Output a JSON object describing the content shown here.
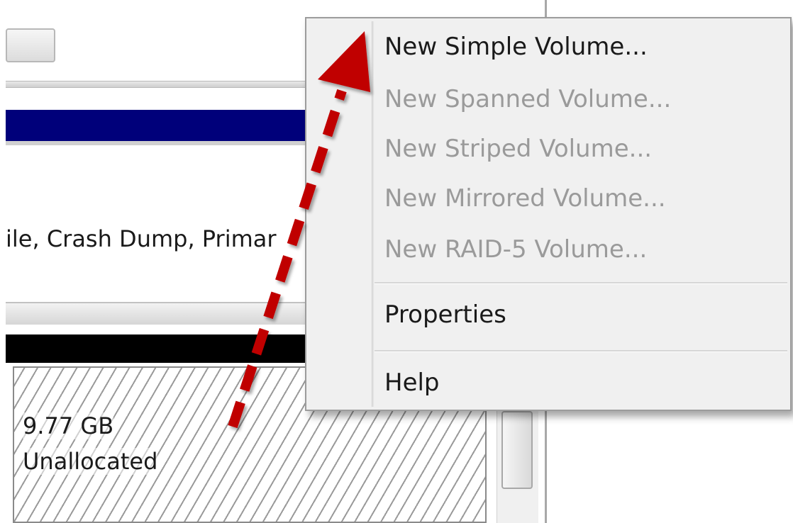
{
  "background": {
    "partition_status": "ile, Crash Dump, Primar",
    "unallocated": {
      "size": "9.77 GB",
      "label": "Unallocated"
    }
  },
  "context_menu": {
    "items": [
      {
        "label": "New Simple Volume...",
        "enabled": true
      },
      {
        "label": "New Spanned Volume...",
        "enabled": false
      },
      {
        "label": "New Striped Volume...",
        "enabled": false
      },
      {
        "label": "New Mirrored Volume...",
        "enabled": false
      },
      {
        "label": "New RAID-5 Volume...",
        "enabled": false
      },
      {
        "label": "Properties",
        "enabled": true
      },
      {
        "label": "Help",
        "enabled": true
      }
    ]
  },
  "colors": {
    "partition_primary": "#00007a",
    "partition_disk": "#000000",
    "annotation_arrow": "#c00000",
    "menu_disabled_text": "#9a9a9a"
  },
  "icons": {
    "annotation": "dashed-arrow-icon"
  }
}
